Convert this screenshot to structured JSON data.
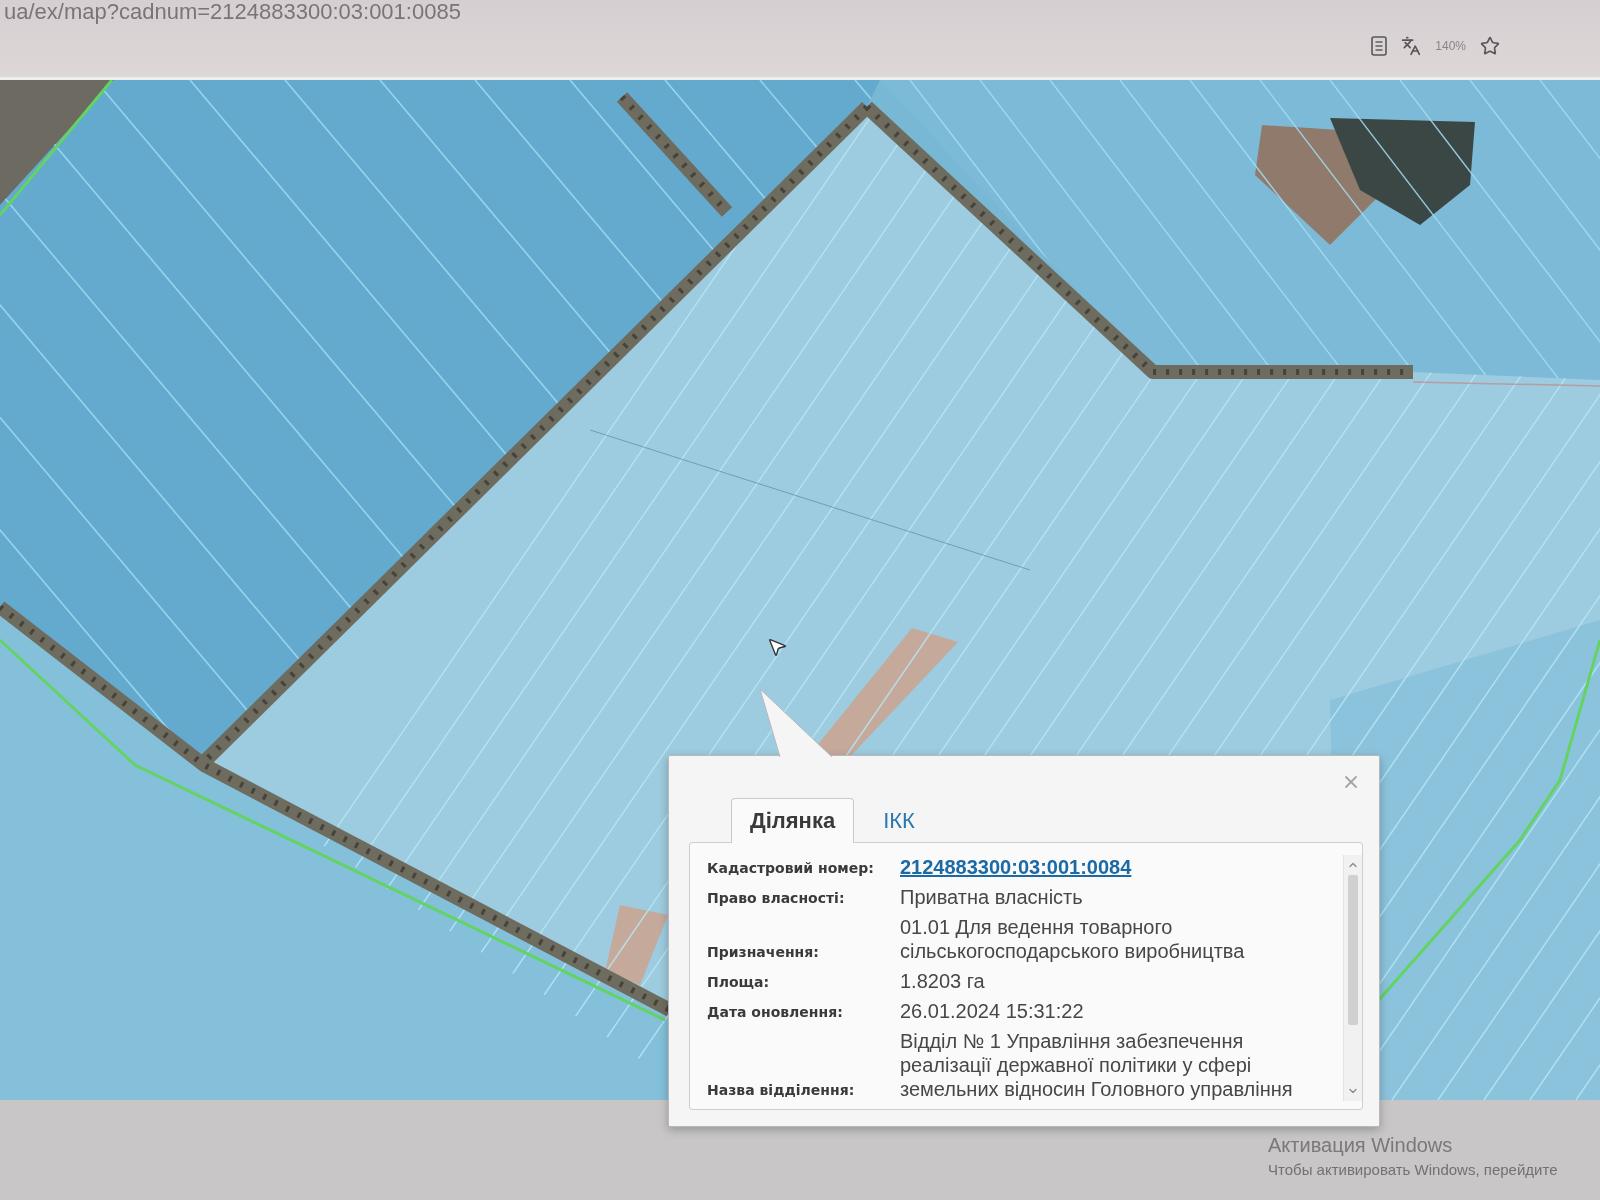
{
  "browser": {
    "url": "ua/ex/map?cadnum=2124883300:03:001:0085",
    "zoom": "140%"
  },
  "popup": {
    "tabs": [
      {
        "label": "Ділянка",
        "selected": true
      },
      {
        "label": "ІКК",
        "selected": false
      }
    ],
    "fields": [
      {
        "label": "Кадастровий номер:",
        "value": "2124883300:03:001:0084",
        "kind": "link"
      },
      {
        "label": "Право власності:",
        "value": "Приватна власність",
        "kind": "text"
      },
      {
        "label": "Призначення:",
        "value": "01.01 Для ведення товарного сільськогосподарського виробництва",
        "kind": "text"
      },
      {
        "label": "Площа:",
        "value": "1.8203 га",
        "kind": "text"
      },
      {
        "label": "Дата оновлення:",
        "value": "26.01.2024 15:31:22",
        "kind": "text"
      },
      {
        "label": "Назва відділення:",
        "value": "Відділ № 1 Управління забезпечення реалізації державної політики у сфері земельних відносин Головного управління",
        "kind": "text"
      }
    ]
  },
  "windows_notice": {
    "title": "Активация Windows",
    "text": "Чтобы активировать Windows, перейдите"
  }
}
